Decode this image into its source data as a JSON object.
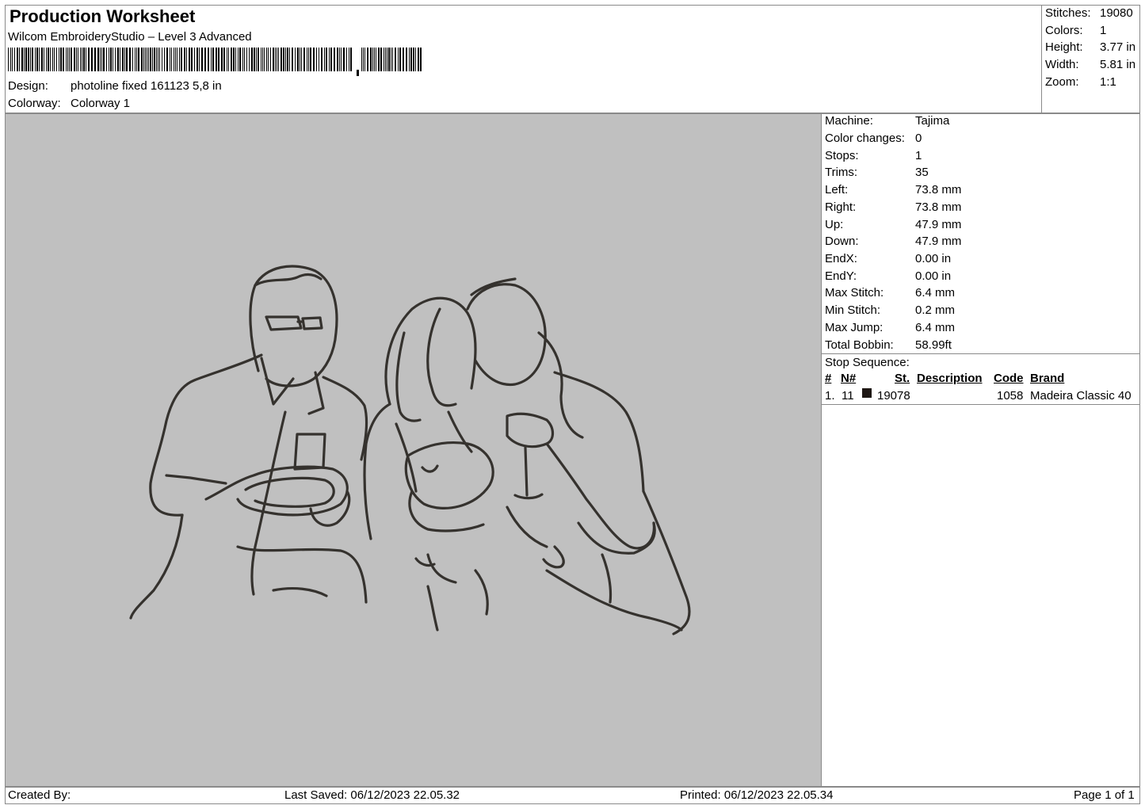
{
  "header": {
    "title": "Production Worksheet",
    "software": "Wilcom EmbroideryStudio – Level 3 Advanced",
    "design_label": "Design:",
    "design_value": "photoline fixed 161123 5,8 in",
    "colorway_label": "Colorway:",
    "colorway_value": "Colorway 1"
  },
  "stats": [
    {
      "label": "Stitches:",
      "value": "19080"
    },
    {
      "label": "Colors:",
      "value": "1"
    },
    {
      "label": "Height:",
      "value": "3.77 in"
    },
    {
      "label": "Width:",
      "value": "5.81 in"
    },
    {
      "label": "Zoom:",
      "value": "1:1"
    }
  ],
  "machine_info": [
    {
      "label": "Machine:",
      "value": "Tajima"
    },
    {
      "label": "Color changes:",
      "value": "0"
    },
    {
      "label": "Stops:",
      "value": "1"
    },
    {
      "label": "Trims:",
      "value": "35"
    },
    {
      "label": "Left:",
      "value": "73.8 mm"
    },
    {
      "label": "Right:",
      "value": "73.8 mm"
    },
    {
      "label": "Up:",
      "value": "47.9 mm"
    },
    {
      "label": "Down:",
      "value": "47.9 mm"
    },
    {
      "label": "EndX:",
      "value": "0.00 in"
    },
    {
      "label": "EndY:",
      "value": "0.00 in"
    },
    {
      "label": "Max Stitch:",
      "value": "6.4 mm"
    },
    {
      "label": "Min Stitch:",
      "value": "0.2 mm"
    },
    {
      "label": "Max Jump:",
      "value": "6.4 mm"
    },
    {
      "label": "Total Bobbin:",
      "value": "58.99ft"
    }
  ],
  "stop_sequence": {
    "title": "Stop Sequence:",
    "columns": [
      "#",
      "N#",
      "St.",
      "Description",
      "Code",
      "Brand"
    ],
    "rows": [
      {
        "index": "1.",
        "needle": "11",
        "stitches": "19078",
        "description": "",
        "code": "1058",
        "brand": "Madeira Classic 40",
        "color": "#1e1714"
      }
    ]
  },
  "footer": {
    "created_by": "Created By:",
    "last_saved": "Last Saved: 06/12/2023 22.05.32",
    "printed": "Printed: 06/12/2023 22.05.34",
    "page": "Page 1 of 1"
  },
  "colors": {
    "preview_background": "#c0c0c0",
    "thread": "#35322e",
    "border": "#8a8a8a"
  }
}
